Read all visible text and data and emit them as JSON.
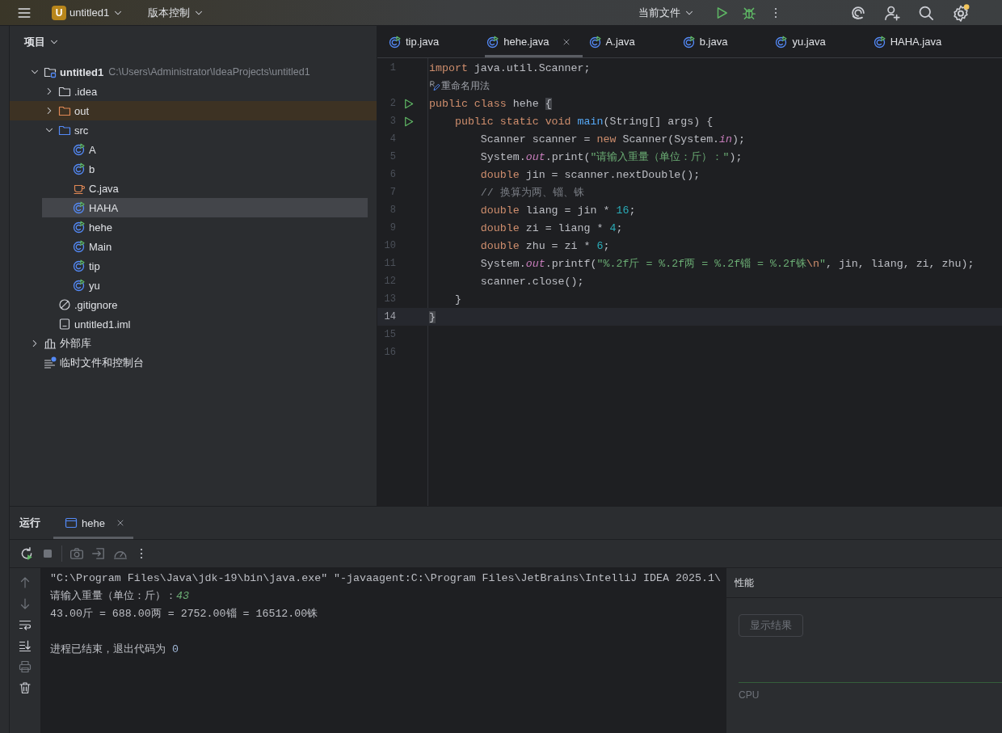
{
  "top_bar": {
    "project_badge": "U",
    "project": "untitled1",
    "vcs": "版本控制",
    "run_config": "当前文件"
  },
  "project": {
    "title": "项目",
    "tree": [
      {
        "label": "untitled1",
        "path": "C:\\Users\\Administrator\\IdeaProjects\\untitled1",
        "kind": "module",
        "expanded": true,
        "selected": false,
        "children": [
          {
            "label": ".idea",
            "kind": "folder",
            "expanded": false,
            "selected": false
          },
          {
            "label": "out",
            "kind": "excluded-folder",
            "expanded": false,
            "selected": false
          },
          {
            "label": "src",
            "kind": "source-folder",
            "expanded": true,
            "selected": false,
            "children": [
              {
                "label": "A",
                "kind": "class",
                "selected": false
              },
              {
                "label": "b",
                "kind": "class",
                "selected": false
              },
              {
                "label": "C.java",
                "kind": "java-file",
                "selected": false
              },
              {
                "label": "HAHA",
                "kind": "class",
                "selected": true
              },
              {
                "label": "hehe",
                "kind": "class",
                "selected": false
              },
              {
                "label": "Main",
                "kind": "class",
                "selected": false
              },
              {
                "label": "tip",
                "kind": "class",
                "selected": false
              },
              {
                "label": "yu",
                "kind": "class",
                "selected": false
              }
            ]
          },
          {
            "label": ".gitignore",
            "kind": "ignore-file",
            "selected": false
          },
          {
            "label": "untitled1.iml",
            "kind": "module-file",
            "selected": false
          }
        ]
      },
      {
        "label": "外部库",
        "kind": "library",
        "expanded": false,
        "selected": false
      },
      {
        "label": "临时文件和控制台",
        "kind": "scratches",
        "selected": false
      }
    ]
  },
  "editor": {
    "tabs": [
      {
        "label": "tip.java",
        "selected": false
      },
      {
        "label": "hehe.java",
        "selected": true
      },
      {
        "label": "A.java",
        "selected": false
      },
      {
        "label": "b.java",
        "selected": false
      },
      {
        "label": "yu.java",
        "selected": false
      },
      {
        "label": "HAHA.java",
        "selected": false
      }
    ],
    "lines": [
      {
        "kind": "code",
        "number": "1",
        "run": false,
        "current": false,
        "tokens": [
          {
            "kind": "keyword",
            "text": "import"
          },
          {
            "kind": "plain",
            "text": " java.util.Scanner;"
          }
        ]
      },
      {
        "kind": "hint",
        "text": "重命名用法"
      },
      {
        "kind": "code",
        "number": "2",
        "run": true,
        "current": false,
        "tokens": [
          {
            "kind": "keyword",
            "text": "public class"
          },
          {
            "kind": "plain",
            "text": " hehe "
          },
          {
            "kind": "brace",
            "text": "{"
          }
        ]
      },
      {
        "kind": "code",
        "number": "3",
        "run": true,
        "current": false,
        "tokens": [
          {
            "kind": "keyword",
            "text": "    public static void"
          },
          {
            "kind": "method",
            "text": " main"
          },
          {
            "kind": "plain",
            "text": "(String[] args) {"
          }
        ]
      },
      {
        "kind": "code",
        "number": "4",
        "run": false,
        "current": false,
        "tokens": [
          {
            "kind": "plain",
            "text": "        Scanner scanner = "
          },
          {
            "kind": "keyword",
            "text": "new"
          },
          {
            "kind": "plain",
            "text": " Scanner(System."
          },
          {
            "kind": "field",
            "text": "in"
          },
          {
            "kind": "plain",
            "text": ");"
          }
        ]
      },
      {
        "kind": "code",
        "number": "5",
        "run": false,
        "current": false,
        "tokens": [
          {
            "kind": "plain",
            "text": "        System."
          },
          {
            "kind": "field",
            "text": "out"
          },
          {
            "kind": "plain",
            "text": ".print("
          },
          {
            "kind": "string",
            "text": "\"请输入重量（单位：斤）：\""
          },
          {
            "kind": "plain",
            "text": ");"
          }
        ]
      },
      {
        "kind": "code",
        "number": "6",
        "run": false,
        "current": false,
        "tokens": [
          {
            "kind": "keyword",
            "text": "        double"
          },
          {
            "kind": "plain",
            "text": " jin = scanner.nextDouble();"
          }
        ]
      },
      {
        "kind": "code",
        "number": "7",
        "run": false,
        "current": false,
        "tokens": [
          {
            "kind": "comment",
            "text": "        // 换算为两、锱、铢"
          }
        ]
      },
      {
        "kind": "code",
        "number": "8",
        "run": false,
        "current": false,
        "tokens": [
          {
            "kind": "keyword",
            "text": "        double"
          },
          {
            "kind": "plain",
            "text": " liang = jin * "
          },
          {
            "kind": "number",
            "text": "16"
          },
          {
            "kind": "plain",
            "text": ";"
          }
        ]
      },
      {
        "kind": "code",
        "number": "9",
        "run": false,
        "current": false,
        "tokens": [
          {
            "kind": "keyword",
            "text": "        double"
          },
          {
            "kind": "plain",
            "text": " zi = liang * "
          },
          {
            "kind": "number",
            "text": "4"
          },
          {
            "kind": "plain",
            "text": ";"
          }
        ]
      },
      {
        "kind": "code",
        "number": "10",
        "run": false,
        "current": false,
        "tokens": [
          {
            "kind": "keyword",
            "text": "        double"
          },
          {
            "kind": "plain",
            "text": " zhu = zi * "
          },
          {
            "kind": "number",
            "text": "6"
          },
          {
            "kind": "plain",
            "text": ";"
          }
        ]
      },
      {
        "kind": "code",
        "number": "11",
        "run": false,
        "current": false,
        "tokens": [
          {
            "kind": "plain",
            "text": "        System."
          },
          {
            "kind": "field",
            "text": "out"
          },
          {
            "kind": "plain",
            "text": ".printf("
          },
          {
            "kind": "string",
            "text": "\"%.2f斤 = %.2f两 = %.2f锱 = %.2f铢"
          },
          {
            "kind": "escape",
            "text": "\\n"
          },
          {
            "kind": "string",
            "text": "\""
          },
          {
            "kind": "plain",
            "text": ", jin, liang, zi, zhu);"
          }
        ]
      },
      {
        "kind": "code",
        "number": "12",
        "run": false,
        "current": false,
        "tokens": [
          {
            "kind": "plain",
            "text": "        scanner.close();"
          }
        ]
      },
      {
        "kind": "code",
        "number": "13",
        "run": false,
        "current": false,
        "tokens": [
          {
            "kind": "plain",
            "text": "    }"
          }
        ]
      },
      {
        "kind": "code",
        "number": "14",
        "run": false,
        "current": true,
        "tokens": [
          {
            "kind": "brace",
            "text": "}"
          }
        ]
      },
      {
        "kind": "code",
        "number": "15",
        "run": false,
        "current": false
      },
      {
        "kind": "code",
        "number": "16",
        "run": false,
        "current": false
      }
    ]
  },
  "run_panel": {
    "title": "运行",
    "tabs": [
      {
        "label": "hehe",
        "selected": true
      }
    ],
    "console": [
      {
        "kind": "command",
        "segments": [
          {
            "kind": "plain",
            "text": "\"C:\\Program Files\\Java\\jdk-19\\bin\\java.exe\" \"-javaagent:C:\\Program Files\\JetBrains\\IntelliJ IDEA 2025.1\\"
          }
        ]
      },
      {
        "kind": "output",
        "segments": [
          {
            "kind": "plain",
            "text": "请输入重量（单位：斤）："
          },
          {
            "kind": "input",
            "text": "43"
          }
        ]
      },
      {
        "kind": "output",
        "segments": [
          {
            "kind": "plain",
            "text": "43.00斤 = 688.00两 = 2752.00锱 = 16512.00铢"
          }
        ]
      },
      {
        "kind": "exit",
        "segments": [
          {
            "kind": "plain",
            "text": "进程已结束，退出代码为 "
          },
          {
            "kind": "code",
            "text": "0"
          }
        ]
      }
    ],
    "performance": {
      "title": "性能",
      "button": "显示结果",
      "button_disabled": true,
      "metric": "CPU"
    }
  }
}
